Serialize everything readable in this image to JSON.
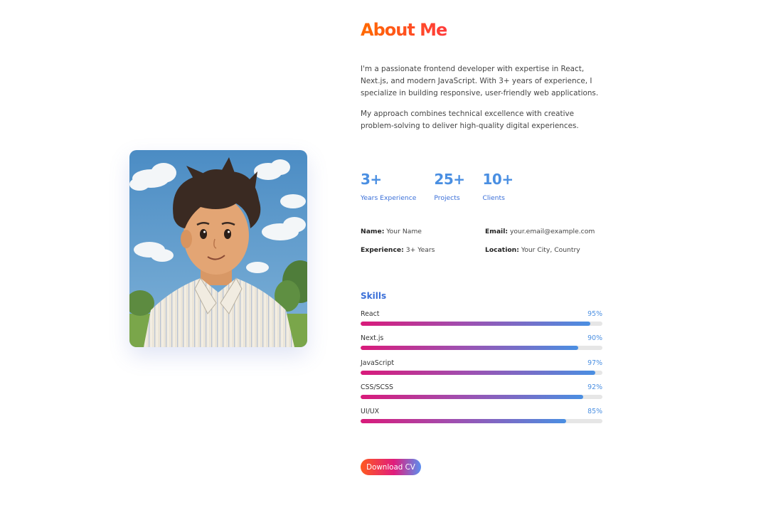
{
  "about": {
    "title": "About Me",
    "paragraph1": "I'm a passionate frontend developer with expertise in React, Next.js, and modern JavaScript. With 3+ years of experience, I specialize in building responsive, user-friendly web applications.",
    "paragraph2": "My approach combines technical excellence with creative problem-solving to deliver high-quality digital experiences."
  },
  "stats": [
    {
      "value": "3+",
      "label": "Years Experience"
    },
    {
      "value": "25+",
      "label": "Projects"
    },
    {
      "value": "10+",
      "label": "Clients"
    }
  ],
  "info": {
    "name": {
      "key": "Name:",
      "value": "Your Name"
    },
    "email": {
      "key": "Email:",
      "value": "your.email@example.com"
    },
    "experience": {
      "key": "Experience:",
      "value": "3+ Years"
    },
    "location": {
      "key": "Location:",
      "value": "Your City, Country"
    }
  },
  "skills": {
    "title": "Skills",
    "items": [
      {
        "name": "React",
        "percent_label": "95%",
        "level": 95
      },
      {
        "name": "Next.js",
        "percent_label": "90%",
        "level": 90
      },
      {
        "name": "JavaScript",
        "percent_label": "97%",
        "level": 97
      },
      {
        "name": "CSS/SCSS",
        "percent_label": "92%",
        "level": 92
      },
      {
        "name": "UI/UX",
        "percent_label": "85%",
        "level": 85
      }
    ]
  },
  "actions": {
    "download_cv": "Download CV"
  },
  "colors": {
    "title_gradient": [
      "#ff6a00",
      "#ff3b3b"
    ],
    "accent_blue": "#4a8fe2",
    "skill_gradient": [
      "#d91a7a",
      "#a04fb0",
      "#4a8fe2"
    ],
    "button_gradient": [
      "#ff5a1f",
      "#e01d7c",
      "#5b8ff0"
    ]
  },
  "portrait": {
    "icon": "profile-portrait-illustration"
  }
}
